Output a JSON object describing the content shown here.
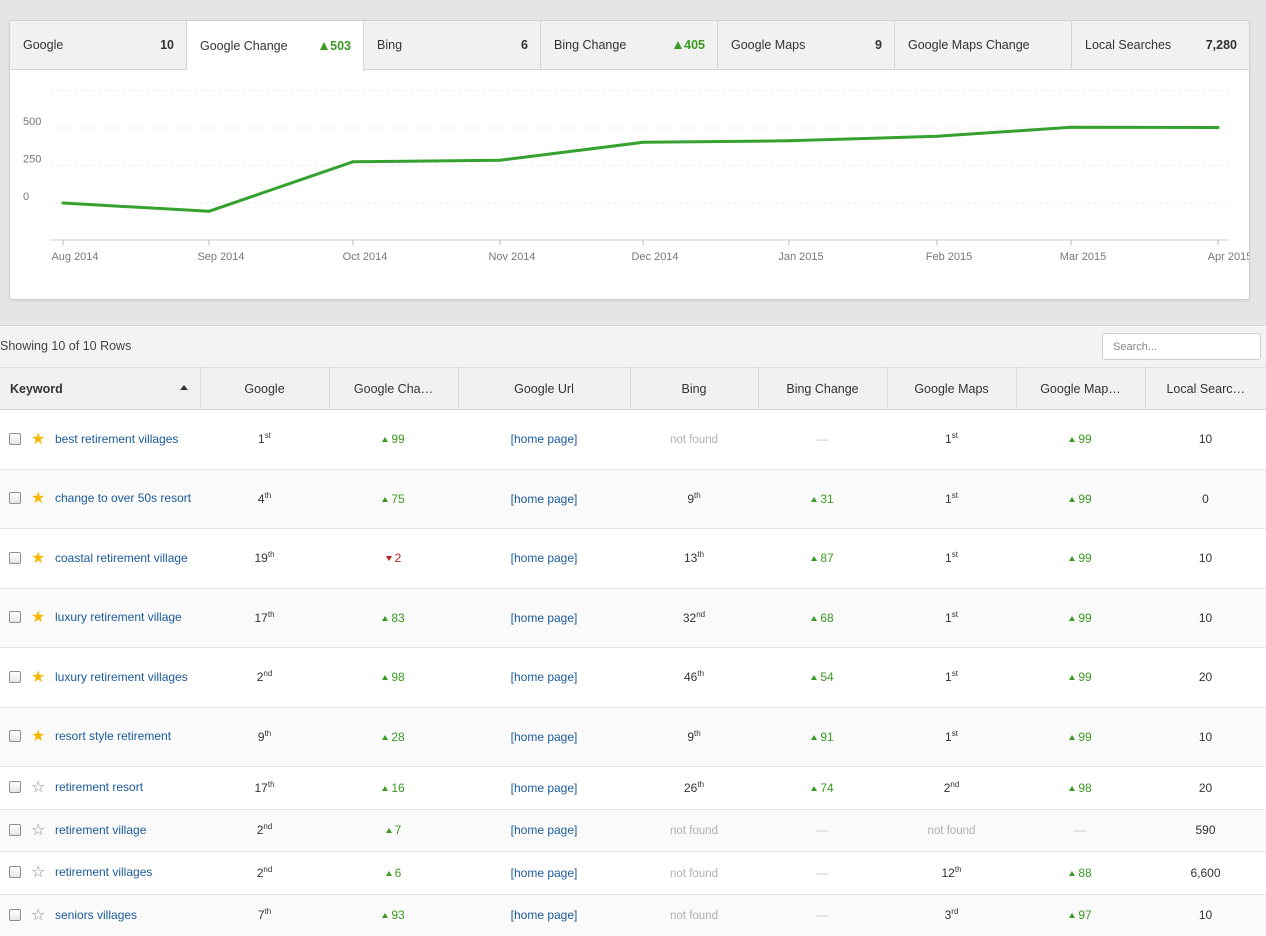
{
  "metrics": [
    {
      "label": "Google",
      "value": "10",
      "trend": ""
    },
    {
      "label": "Google Change",
      "value": "503",
      "trend": "up"
    },
    {
      "label": "Bing",
      "value": "6",
      "trend": ""
    },
    {
      "label": "Bing Change",
      "value": "405",
      "trend": "up"
    },
    {
      "label": "Google Maps",
      "value": "9",
      "trend": ""
    },
    {
      "label": "Google Maps Change",
      "value": "",
      "trend": ""
    },
    {
      "label": "Local Searches",
      "value": "7,280",
      "trend": ""
    }
  ],
  "active_metric": 1,
  "chart_data": {
    "type": "line",
    "x": [
      "Aug 2014",
      "Sep 2014",
      "Oct 2014",
      "Nov 2014",
      "Dec 2014",
      "Jan 2015",
      "Feb 2015",
      "Mar 2015",
      "Apr 2015"
    ],
    "y_ticks": [
      "500",
      "250",
      "0"
    ],
    "series": [
      {
        "values": [
          0,
          -55,
          275,
          285,
          405,
          415,
          445,
          505,
          503
        ]
      }
    ],
    "ylim": [
      -250,
      750
    ],
    "grid": true,
    "colors": {
      "line": "#35a12e"
    }
  },
  "table": {
    "row_count_text": "Showing 10 of 10 Rows",
    "search_placeholder": "Search...",
    "columns": [
      "Keyword",
      "Google",
      "Google Cha…",
      "Google Url",
      "Bing",
      "Bing Change",
      "Google Maps",
      "Google Map…",
      "Local Searc…"
    ],
    "rows": [
      {
        "keyword": "best retirement villages",
        "starred": true,
        "google": {
          "n": "1",
          "s": "st"
        },
        "google_change": {
          "dir": "up",
          "v": "99"
        },
        "url": "[home page]",
        "bing": {
          "n": "not found",
          "s": ""
        },
        "bing_change": {
          "dir": "none",
          "v": "—"
        },
        "maps": {
          "n": "1",
          "s": "st"
        },
        "maps_change": {
          "dir": "up",
          "v": "99"
        },
        "local": "10"
      },
      {
        "keyword": "change to over 50s resort",
        "starred": true,
        "google": {
          "n": "4",
          "s": "th"
        },
        "google_change": {
          "dir": "up",
          "v": "75"
        },
        "url": "[home page]",
        "bing": {
          "n": "9",
          "s": "th"
        },
        "bing_change": {
          "dir": "up",
          "v": "31"
        },
        "maps": {
          "n": "1",
          "s": "st"
        },
        "maps_change": {
          "dir": "up",
          "v": "99"
        },
        "local": "0"
      },
      {
        "keyword": "coastal retirement village",
        "starred": true,
        "google": {
          "n": "19",
          "s": "th"
        },
        "google_change": {
          "dir": "down",
          "v": "2"
        },
        "url": "[home page]",
        "bing": {
          "n": "13",
          "s": "th"
        },
        "bing_change": {
          "dir": "up",
          "v": "87"
        },
        "maps": {
          "n": "1",
          "s": "st"
        },
        "maps_change": {
          "dir": "up",
          "v": "99"
        },
        "local": "10"
      },
      {
        "keyword": "luxury retirement village",
        "starred": true,
        "google": {
          "n": "17",
          "s": "th"
        },
        "google_change": {
          "dir": "up",
          "v": "83"
        },
        "url": "[home page]",
        "bing": {
          "n": "32",
          "s": "nd"
        },
        "bing_change": {
          "dir": "up",
          "v": "68"
        },
        "maps": {
          "n": "1",
          "s": "st"
        },
        "maps_change": {
          "dir": "up",
          "v": "99"
        },
        "local": "10"
      },
      {
        "keyword": "luxury retirement villages",
        "starred": true,
        "google": {
          "n": "2",
          "s": "nd"
        },
        "google_change": {
          "dir": "up",
          "v": "98"
        },
        "url": "[home page]",
        "bing": {
          "n": "46",
          "s": "th"
        },
        "bing_change": {
          "dir": "up",
          "v": "54"
        },
        "maps": {
          "n": "1",
          "s": "st"
        },
        "maps_change": {
          "dir": "up",
          "v": "99"
        },
        "local": "20"
      },
      {
        "keyword": "resort style retirement",
        "starred": true,
        "google": {
          "n": "9",
          "s": "th"
        },
        "google_change": {
          "dir": "up",
          "v": "28"
        },
        "url": "[home page]",
        "bing": {
          "n": "9",
          "s": "th"
        },
        "bing_change": {
          "dir": "up",
          "v": "91"
        },
        "maps": {
          "n": "1",
          "s": "st"
        },
        "maps_change": {
          "dir": "up",
          "v": "99"
        },
        "local": "10"
      },
      {
        "keyword": "retirement resort",
        "starred": false,
        "google": {
          "n": "17",
          "s": "th"
        },
        "google_change": {
          "dir": "up",
          "v": "16"
        },
        "url": "[home page]",
        "bing": {
          "n": "26",
          "s": "th"
        },
        "bing_change": {
          "dir": "up",
          "v": "74"
        },
        "maps": {
          "n": "2",
          "s": "nd"
        },
        "maps_change": {
          "dir": "up",
          "v": "98"
        },
        "local": "20"
      },
      {
        "keyword": "retirement village",
        "starred": false,
        "google": {
          "n": "2",
          "s": "nd"
        },
        "google_change": {
          "dir": "up",
          "v": "7"
        },
        "url": "[home page]",
        "bing": {
          "n": "not found",
          "s": ""
        },
        "bing_change": {
          "dir": "none",
          "v": "—"
        },
        "maps": {
          "n": "not found",
          "s": ""
        },
        "maps_change": {
          "dir": "none",
          "v": "—"
        },
        "local": "590"
      },
      {
        "keyword": "retirement villages",
        "starred": false,
        "google": {
          "n": "2",
          "s": "nd"
        },
        "google_change": {
          "dir": "up",
          "v": "6"
        },
        "url": "[home page]",
        "bing": {
          "n": "not found",
          "s": ""
        },
        "bing_change": {
          "dir": "none",
          "v": "—"
        },
        "maps": {
          "n": "12",
          "s": "th"
        },
        "maps_change": {
          "dir": "up",
          "v": "88"
        },
        "local": "6,600"
      },
      {
        "keyword": "seniors villages",
        "starred": false,
        "google": {
          "n": "7",
          "s": "th"
        },
        "google_change": {
          "dir": "up",
          "v": "93"
        },
        "url": "[home page]",
        "bing": {
          "n": "not found",
          "s": ""
        },
        "bing_change": {
          "dir": "none",
          "v": "—"
        },
        "maps": {
          "n": "3",
          "s": "rd"
        },
        "maps_change": {
          "dir": "up",
          "v": "97"
        },
        "local": "10"
      }
    ]
  }
}
